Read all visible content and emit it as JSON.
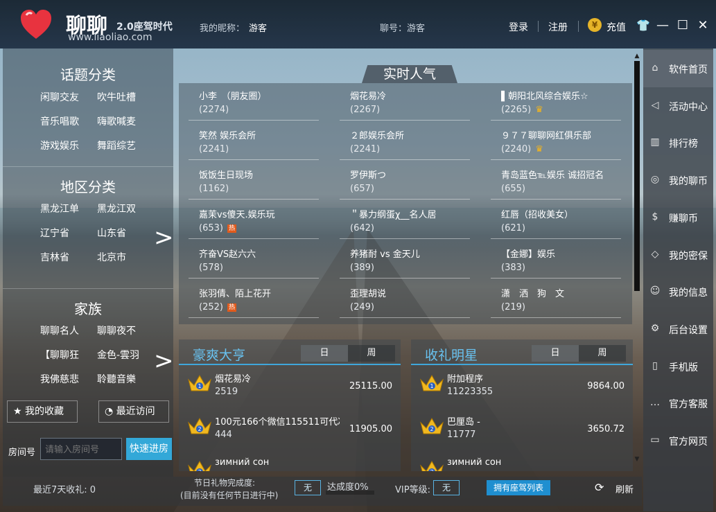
{
  "app": {
    "name": "聊聊",
    "subtitle": "2.0座驾时代",
    "url": "www.liaoliao.com"
  },
  "header": {
    "nick_label": "我的昵称：",
    "nick_value": "游客",
    "uid_label": "聊号：游客",
    "login": "登录",
    "register": "注册",
    "recharge": "充值",
    "coin_symbol": "¥"
  },
  "left": {
    "topics_title": "话题分类",
    "topics": [
      "闲聊交友",
      "吹牛吐槽",
      "音乐唱歌",
      "嗨歌喊麦",
      "游戏娱乐",
      "舞蹈综艺"
    ],
    "regions_title": "地区分类",
    "regions": [
      "黑龙江单",
      "黑龙江双",
      "辽宁省",
      "山东省",
      "吉林省",
      "北京市"
    ],
    "family_title": "家族",
    "families": [
      "聊聊名人",
      "聊聊夜不",
      "【聊聊狂",
      "金色-雲羽",
      "我佛慈悲",
      "聆聽音樂"
    ],
    "favorites": "我的收藏",
    "recent": "最近访问",
    "room_label": "房间号",
    "room_placeholder": "请输入房间号",
    "quick_enter": "快速进房"
  },
  "popular": {
    "title": "实时人气",
    "rooms": [
      {
        "name": "小李　（朋友圈）",
        "count": "(2274)",
        "badge": ""
      },
      {
        "name": "烟花易冷",
        "count": "(2267)",
        "badge": ""
      },
      {
        "name": "▌朝阳北风综合娱乐☆",
        "count": "(2265)",
        "badge": "crown"
      },
      {
        "name": "笑然 娱乐会所",
        "count": "(2241)",
        "badge": ""
      },
      {
        "name": "２郎娱乐会所",
        "count": "(2241)",
        "badge": ""
      },
      {
        "name": "９７７聊聊网红俱乐部",
        "count": "(2240)",
        "badge": "crown"
      },
      {
        "name": "饭饭生日现场",
        "count": "(1162)",
        "badge": ""
      },
      {
        "name": "罗伊斯つ",
        "count": "(657)",
        "badge": ""
      },
      {
        "name": "青岛蓝色℡娱乐 诚招冠名",
        "count": "(655)",
        "badge": ""
      },
      {
        "name": "嘉茉vs傻天.娱乐玩",
        "count": "(653)",
        "badge": "hot"
      },
      {
        "name": "＂暴力纲蛋χ__名人居",
        "count": "(642)",
        "badge": ""
      },
      {
        "name": "红唇（招收美女）",
        "count": "(621)",
        "badge": ""
      },
      {
        "name": "齐奋VS赵六六",
        "count": "(578)",
        "badge": ""
      },
      {
        "name": "养猪耐 vs 金天儿",
        "count": "(389)",
        "badge": ""
      },
      {
        "name": "【金娜】娱乐",
        "count": "(383)",
        "badge": ""
      },
      {
        "name": "张羽倩、陌上花开",
        "count": "(252)",
        "badge": "hot"
      },
      {
        "name": "歪理胡说",
        "count": "(249)",
        "badge": ""
      },
      {
        "name": "潇　洒　狗　文",
        "count": "(219)",
        "badge": ""
      }
    ],
    "hot_label": "热"
  },
  "rich": {
    "title": "豪爽大亨",
    "tab_day": "日",
    "tab_week": "周",
    "rows": [
      {
        "rank": "1",
        "name": "烟花易冷",
        "id": "2519",
        "value": "25115.00"
      },
      {
        "rank": "2",
        "name": "100元166个微信115511可代冲",
        "id": "444",
        "value": "11905.00"
      },
      {
        "rank": "3",
        "name": "зимний сон",
        "id": "",
        "value": ""
      }
    ]
  },
  "stars": {
    "title": "收礼明星",
    "tab_day": "日",
    "tab_week": "周",
    "rows": [
      {
        "rank": "1",
        "name": "附加程序",
        "id": "11223355",
        "value": "9864.00"
      },
      {
        "rank": "2",
        "name": "巴厘岛 -",
        "id": "11777",
        "value": "3650.72"
      },
      {
        "rank": "3",
        "name": "зимний сон",
        "id": "",
        "value": ""
      }
    ]
  },
  "bottom": {
    "recent_gift": "最近7天收礼: 0",
    "festival_line1": "节日礼物完成度:",
    "festival_line2": "(目前没有任何节日进行中)",
    "festival_value": "无",
    "completion": "达成度0%",
    "completion_value": 0,
    "vip_label": "VIP等级:",
    "vip_value": "无",
    "seat_list": "拥有座驾列表",
    "refresh": "刷新"
  },
  "sidebar": {
    "items": [
      {
        "label": "软件首页",
        "icon": "home-icon",
        "glyph": "⌂"
      },
      {
        "label": "活动中心",
        "icon": "megaphone-icon",
        "glyph": "◁"
      },
      {
        "label": "排行榜",
        "icon": "bar-chart-icon",
        "glyph": "▥"
      },
      {
        "label": "我的聊币",
        "icon": "coin-icon",
        "glyph": "◎"
      },
      {
        "label": "赚聊币",
        "icon": "dollar-icon",
        "glyph": "$"
      },
      {
        "label": "我的密保",
        "icon": "shield-icon",
        "glyph": "◇"
      },
      {
        "label": "我的信息",
        "icon": "user-icon",
        "glyph": "☺"
      },
      {
        "label": "后台设置",
        "icon": "settings-icon",
        "glyph": "⚙"
      },
      {
        "label": "手机版",
        "icon": "phone-icon",
        "glyph": "▯"
      },
      {
        "label": "官方客服",
        "icon": "chat-icon",
        "glyph": "…"
      },
      {
        "label": "官方网页",
        "icon": "monitor-icon",
        "glyph": "▭"
      }
    ]
  },
  "colors": {
    "accent": "#33a8d8",
    "title_blue": "#68c1ef",
    "crown": "#f3b51d",
    "hot": "#e05a1c"
  }
}
